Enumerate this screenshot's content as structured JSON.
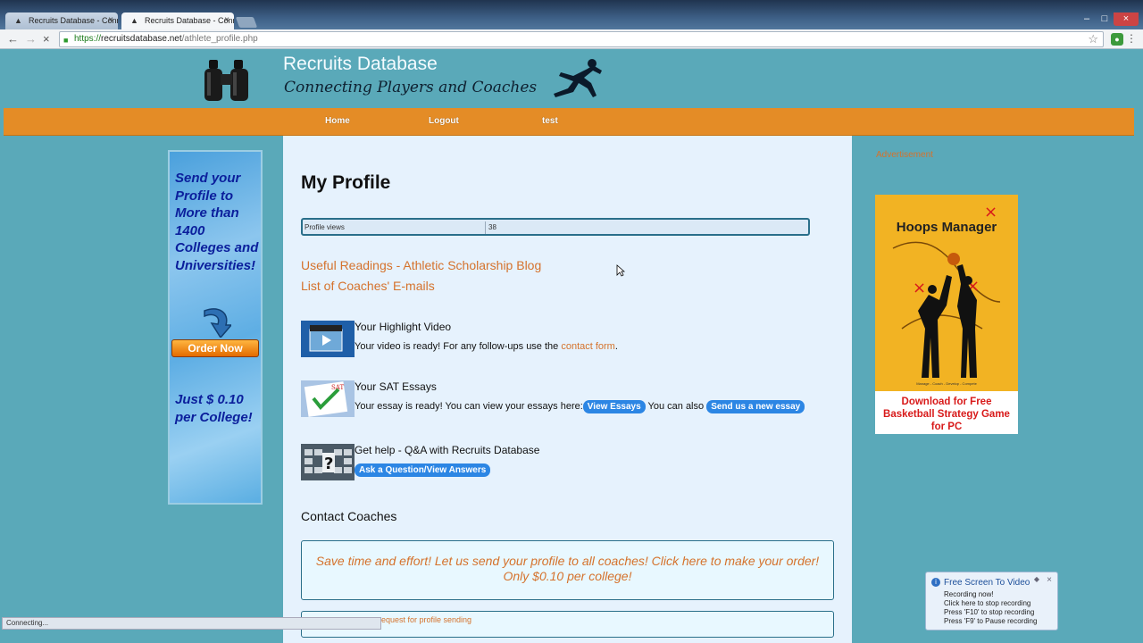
{
  "browser": {
    "tabs": [
      {
        "title": "Recruits Database - Conn",
        "active": false
      },
      {
        "title": "Recruits Database - Conn",
        "active": true
      }
    ],
    "url": {
      "scheme": "https://",
      "host": "recruitsdatabase.net",
      "path": "/athlete_profile.php"
    },
    "status_text": "Connecting..."
  },
  "header": {
    "title": "Recruits Database",
    "subtitle": "Connecting Players and Coaches"
  },
  "nav": {
    "items": [
      {
        "label": "Home"
      },
      {
        "label": "Logout"
      },
      {
        "label": "test"
      }
    ]
  },
  "left_ad": {
    "text": "Send your Profile to More than 1400 Colleges and Universities!",
    "button": "Order Now",
    "price": "Just $ 0.10 per College!"
  },
  "main": {
    "title": "My Profile",
    "profile_views": {
      "label": "Profile views",
      "value": "38"
    },
    "links": [
      "Useful Readings - Athletic Scholarship Blog",
      "List of Coaches' E-mails"
    ],
    "video": {
      "title": "Your Highlight Video",
      "text_before": "Your video is ready! For any follow-ups use the ",
      "link": "contact form",
      "text_after": "."
    },
    "sat": {
      "title": "Your SAT Essays",
      "text_before": "Your essay is ready! You can view your essays here:",
      "button1": "View Essays",
      "text_middle": " You can also ",
      "button2": "Send us a new essay"
    },
    "help": {
      "title": "Get help - Q&A with Recruits Database",
      "button": "Ask a Question/View Answers"
    },
    "contact": {
      "heading": "Contact Coaches",
      "promo": "Save time and effort! Let us send your profile to all coaches! Click here to make your order! Only $0.10 per college!",
      "request_text": "request for profile sending"
    }
  },
  "right_ad": {
    "label": "Advertisement",
    "title": "Hoops Manager",
    "tagline": "Manage - Coach - Develop - Compete",
    "cta": "Download for Free Basketball Strategy Game for PC"
  },
  "recorder": {
    "title": "Free Screen To Video",
    "lines": [
      "Recording now!",
      "Click here to stop recording",
      "Press 'F10' to stop recording",
      "Press 'F9' to Pause recording"
    ]
  }
}
